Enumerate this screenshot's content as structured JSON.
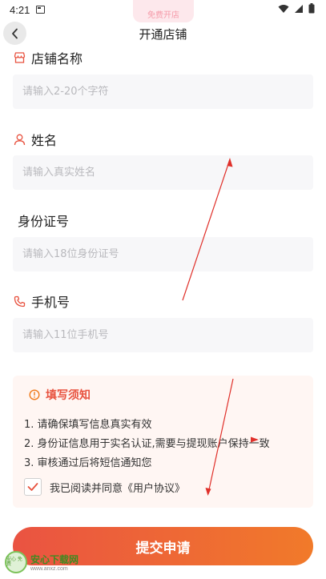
{
  "status_bar": {
    "time": "4:21"
  },
  "banner": {
    "text": "免费开店"
  },
  "header": {
    "title": "开通店铺"
  },
  "form": {
    "shop_name": {
      "label": "店铺名称",
      "placeholder": "请输入2-20个字符"
    },
    "name": {
      "label": "姓名",
      "placeholder": "请输入真实姓名"
    },
    "id_number": {
      "label": "身份证号",
      "placeholder": "请输入18位身份证号"
    },
    "phone": {
      "label": "手机号",
      "placeholder": "请输入11位手机号"
    }
  },
  "notice": {
    "title": "填写须知",
    "items": [
      "1. 请确保填写信息真实有效",
      "2. 身份证信息用于实名认证,需要与提现账户保持一致",
      "3. 审核通过后将短信通知您"
    ],
    "agreement": "我已阅读并同意《用户协议》",
    "agreement_checked": true
  },
  "submit": {
    "label": "提交申请"
  },
  "watermark": {
    "logo_text": "安心 免费",
    "name": "安心下载网",
    "url": "www.anxz.com"
  },
  "colors": {
    "accent": "#e8523f",
    "gradient_start": "#ea5342",
    "gradient_end": "#f17a2a",
    "input_bg": "#f7f7f9",
    "notice_bg": "#fff6f3"
  }
}
